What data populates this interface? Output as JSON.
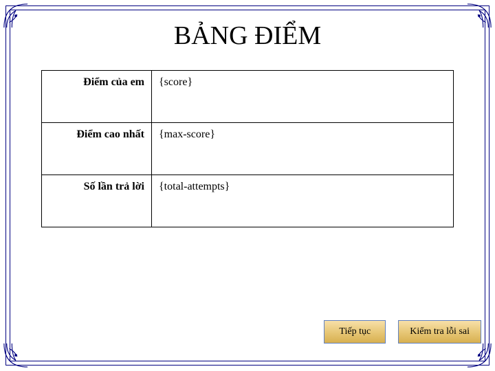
{
  "title": "BẢNG ĐIỂM",
  "rows": [
    {
      "label": "Điểm của em",
      "value": "{score}"
    },
    {
      "label": "Điểm cao nhất",
      "value": "{max-score}"
    },
    {
      "label": "Số lần trả lời",
      "value": "{total-attempts}"
    }
  ],
  "buttons": {
    "continue": "Tiếp tục",
    "review": "Kiểm tra lỗi sai"
  },
  "colors": {
    "frame": "#000080",
    "button_bg": "#e8c878",
    "button_border": "#6080c0"
  }
}
